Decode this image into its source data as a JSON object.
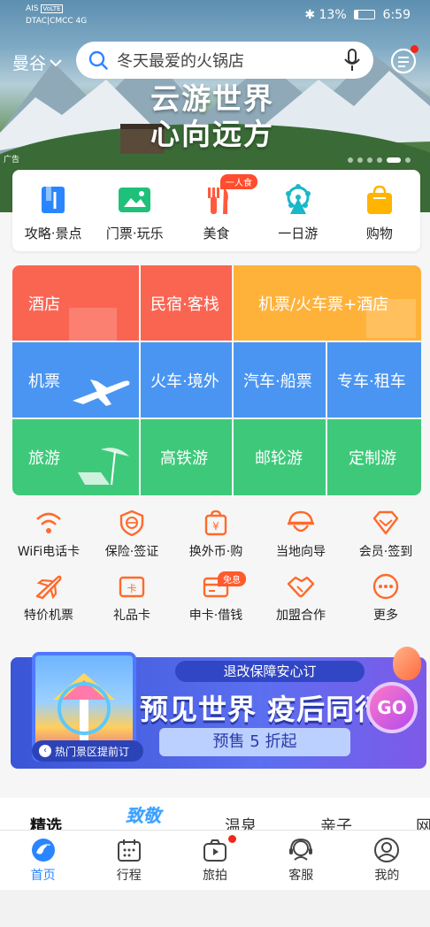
{
  "status_bar": {
    "carrier1": "AIS",
    "volte": "VoLTE",
    "carrier2": "DTAC|CMCC",
    "network": "4G",
    "battery": "13%",
    "time": "6:59"
  },
  "top_bar": {
    "city": "曼谷",
    "search_placeholder": "冬天最爱的火锅店"
  },
  "banner": {
    "slogan_line1": "云游世界",
    "slogan_line2": "心向远方",
    "ad_tag": "广告"
  },
  "quick_nav": {
    "items": [
      {
        "label": "攻略·景点",
        "icon": "guide-book-icon",
        "color": "#2a86ff"
      },
      {
        "label": "门票·玩乐",
        "icon": "ticket-image-icon",
        "color": "#1fc07a"
      },
      {
        "label": "美食",
        "icon": "fork-knife-icon",
        "color": "#ff5a3c"
      },
      {
        "label": "一日游",
        "icon": "ferris-wheel-icon",
        "color": "#19b8c8"
      },
      {
        "label": "购物",
        "icon": "shopping-bag-icon",
        "color": "#ffb400"
      }
    ],
    "food_badge": "一人食"
  },
  "main_grid": {
    "hotel": "酒店",
    "homestay": "民宿·客栈",
    "flight_train_hotel": "机票/火车票+酒店",
    "flight": "机票",
    "train": "火车·境外",
    "bus_ship": "汽车·船票",
    "car_rental": "专车·租车",
    "travel": "旅游",
    "highspeed_rail": "高铁游",
    "cruise": "邮轮游",
    "custom": "定制游",
    "colors": {
      "red": "#fa6552",
      "orange": "#ffb23a",
      "blue": "#4a95f2",
      "green": "#3ec97a"
    }
  },
  "services": {
    "row1": [
      {
        "label": "WiFi电话卡",
        "icon": "wifi-icon"
      },
      {
        "label": "保险·签证",
        "icon": "shield-icon"
      },
      {
        "label": "换外币·购",
        "icon": "currency-bag-icon"
      },
      {
        "label": "当地向导",
        "icon": "guide-hat-icon"
      },
      {
        "label": "会员·签到",
        "icon": "diamond-icon"
      }
    ],
    "row2": [
      {
        "label": "特价机票",
        "icon": "plane-icon"
      },
      {
        "label": "礼品卡",
        "icon": "gift-card-icon"
      },
      {
        "label": "申卡·借钱",
        "icon": "credit-card-icon"
      },
      {
        "label": "加盟合作",
        "icon": "handshake-icon"
      },
      {
        "label": "更多",
        "icon": "more-dots-icon"
      }
    ],
    "card_badge": "免息",
    "accent": "#ff6a2b"
  },
  "promo": {
    "subtitle": "退改保障安心订",
    "headline": "预见世界 疫后同行",
    "presale": "预售 5 折起",
    "go": "GO",
    "image_caption": "热门景区提前订"
  },
  "category_tabs": {
    "items": [
      "精选",
      "温泉",
      "亲子",
      "网"
    ],
    "special": "致敬"
  },
  "tab_bar": {
    "items": [
      {
        "label": "首页",
        "icon": "ctrip-dolphin-icon"
      },
      {
        "label": "行程",
        "icon": "calendar-icon"
      },
      {
        "label": "旅拍",
        "icon": "camera-icon"
      },
      {
        "label": "客服",
        "icon": "headset-icon"
      },
      {
        "label": "我的",
        "icon": "user-icon"
      }
    ],
    "active_color": "#2a86ff"
  }
}
